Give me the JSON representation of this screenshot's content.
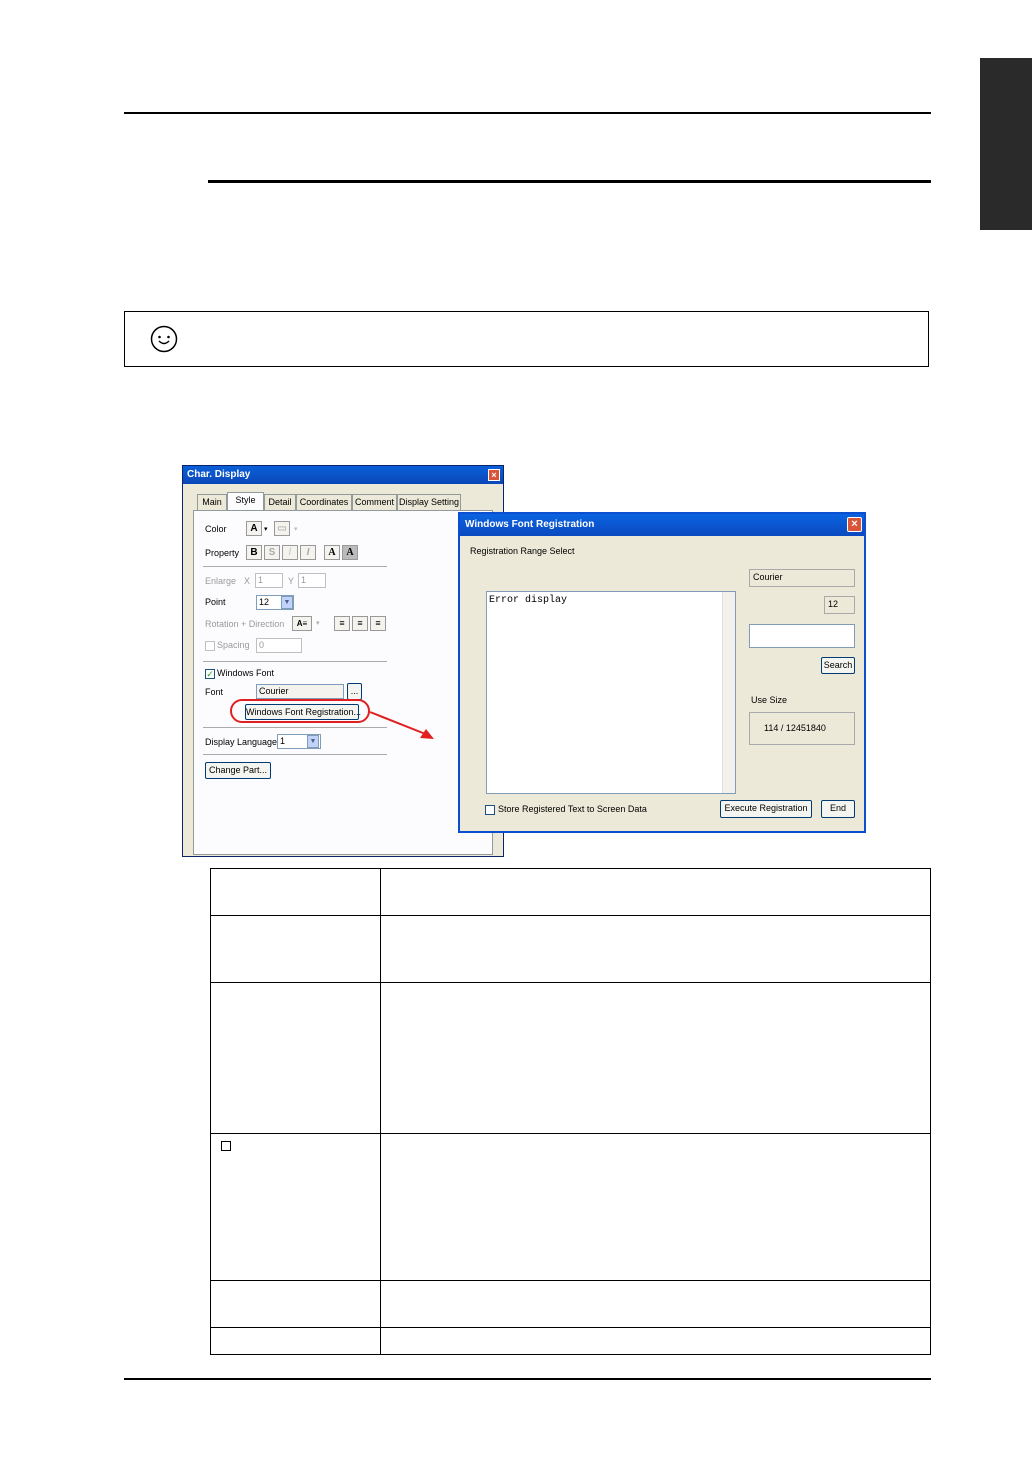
{
  "char_display": {
    "title": "Char. Display",
    "close": "×",
    "tabs": [
      "Main",
      "Style",
      "Detail",
      "Coordinates",
      "Comment",
      "Display Setting"
    ],
    "color_label": "Color",
    "property_label": "Property",
    "property_buttons": [
      "B",
      "S",
      "/",
      "I",
      "A",
      "A"
    ],
    "enlarge_label": "Enlarge",
    "x_label": "X",
    "y_label": "Y",
    "enlarge_x": "1",
    "enlarge_y": "1",
    "point_label": "Point",
    "point_value": "12",
    "rotation_label": "Rotation + Direction",
    "spacing_label": "Spacing",
    "spacing_value": "0",
    "windows_font_label": "Windows Font",
    "font_label": "Font",
    "font_value": "Courier",
    "browse_label": "...",
    "wfr_button": "Windows Font Registration...",
    "display_language_label": "Display Language",
    "display_language_value": "1",
    "change_part_button": "Change Part..."
  },
  "font_registration": {
    "title": "Windows Font Registration",
    "close": "×",
    "range_label": "Registration Range Select",
    "text": "Error display",
    "font_name": "Courier",
    "font_size": "12",
    "search_button": "Search",
    "use_size_label": "Use Size",
    "use_size_value": "114 / 12451840",
    "store_label": "Store Registered Text to Screen Data",
    "execute_button": "Execute Registration",
    "end_button": "End"
  },
  "icons": [
    "smiley-icon",
    "close-icon",
    "chevron-down-icon",
    "align-left-icon",
    "align-center-icon",
    "align-right-icon",
    "arrow-icon"
  ],
  "colors": {
    "highlight": "#e02020",
    "titlebar": "#0a5fd8"
  }
}
